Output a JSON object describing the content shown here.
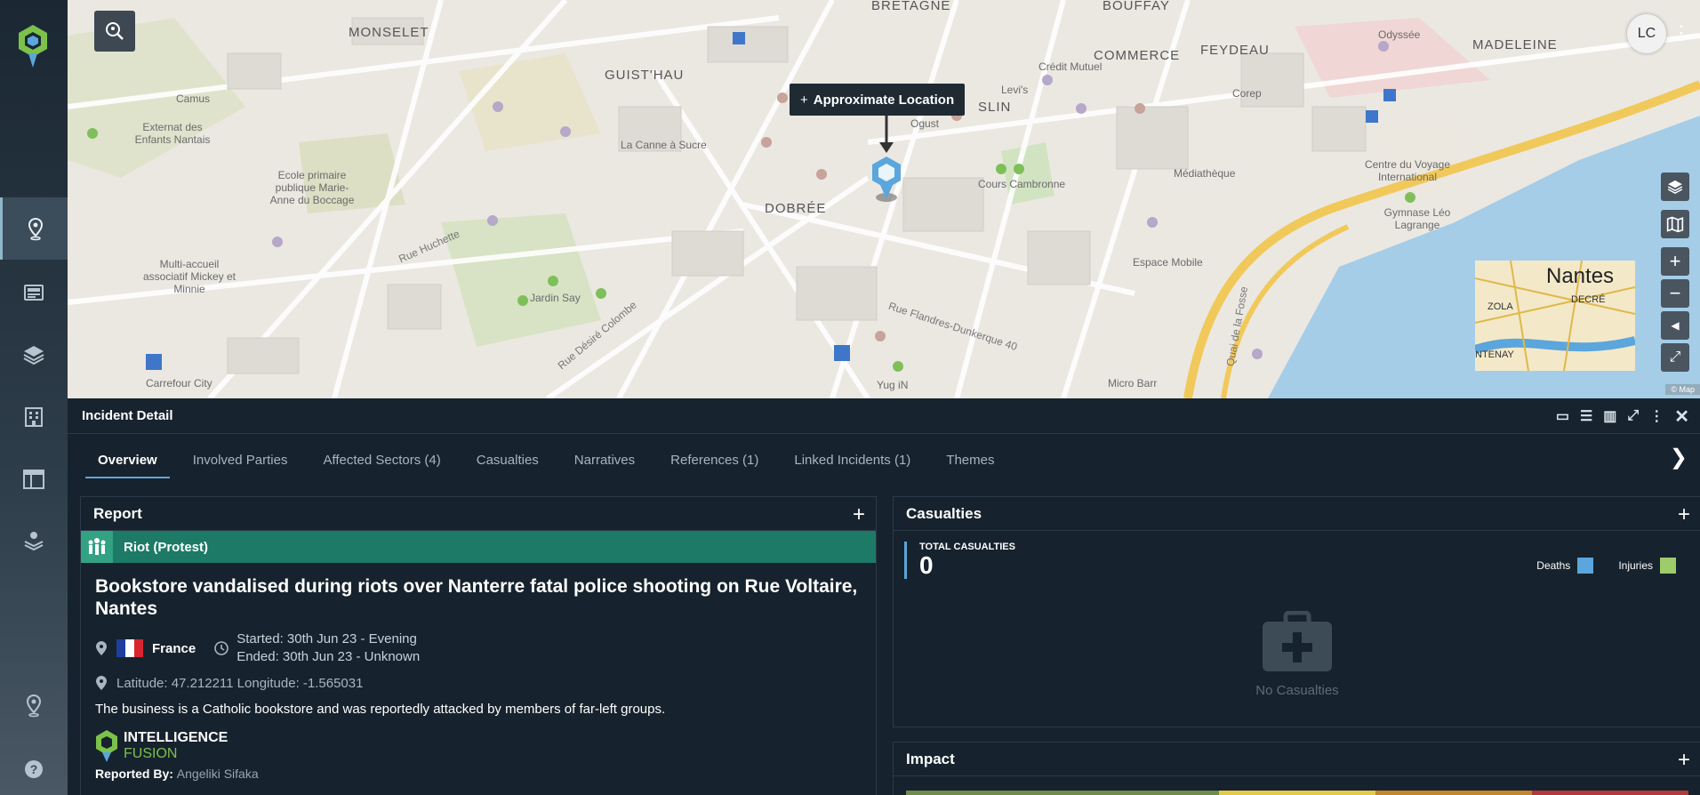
{
  "user": {
    "initials": "LC"
  },
  "map": {
    "tooltip": "Approximate Location",
    "labels": {
      "monselet": "MONSELET",
      "bretagne": "BRETAGNE",
      "bouffay": "BOUFFAY",
      "commerce": "COMMERCE",
      "feydeau": "FEYDEAU",
      "madeleine": "MADELEINE",
      "guisthau": "GUIST'HAU",
      "dobree": "DOBRÉE",
      "graslin": "SLIN",
      "camus": "Camus",
      "externat": "Externat des Enfants Nantais",
      "ecole": "Ecole primaire publique Marie-Anne du Boccage",
      "multiaccueil": "Multi-accueil associatif Mickey et Minnie",
      "carrefour": "Carrefour City",
      "jardin": "Jardin Say",
      "canne": "La Canne à Sucre",
      "ogust": "Ogust",
      "credit": "Crédit Mutuel",
      "levis": "Levi's",
      "corep": "Corep",
      "mediatheque": "Médiathèque",
      "cambronne": "Cours Cambronne",
      "espace": "Espace Mobile",
      "centre": "Centre du Voyage International",
      "gymnase": "Gymnase Léo Lagrange",
      "yug": "Yug iN",
      "microbarr": "Micro Barr",
      "rue_desire": "Rue Désiré Colombe",
      "rue_flandres": "Rue Flandres-Dunkerque 40",
      "rue_huchette": "Rue Huchette",
      "quai": "Quai de la Fosse",
      "odyssee": "Odyssée"
    },
    "minimap": {
      "title": "Nantes",
      "l1": "DECRÉ",
      "l2": "ZOLA",
      "l3": "NTENAY"
    },
    "attribution": "© Map"
  },
  "panel": {
    "title": "Incident Detail",
    "tabs": [
      "Overview",
      "Involved Parties",
      "Affected Sectors (4)",
      "Casualties",
      "Narratives",
      "References (1)",
      "Linked Incidents (1)",
      "Themes"
    ]
  },
  "report": {
    "heading": "Report",
    "type": "Riot (Protest)",
    "title": "Bookstore vandalised during riots over Nanterre fatal police shooting on Rue Voltaire, Nantes",
    "country": "France",
    "started": "Started: 30th Jun 23 - Evening",
    "ended": "Ended: 30th Jun 23 - Unknown",
    "latlon": "Latitude: 47.212211 Longitude: -1.565031",
    "description": "The business is a Catholic bookstore and was reportedly attacked by members of far-left groups.",
    "source_line1": "INTELLIGENCE",
    "source_line2": "FUSION",
    "reported_by_label": "Reported By:",
    "reported_by": "Angeliki Sifaka"
  },
  "casualties": {
    "heading": "Casualties",
    "total_label": "TOTAL CASUALTIES",
    "total": "0",
    "legend": [
      {
        "label": "Deaths",
        "color": "#5ba6dc"
      },
      {
        "label": "Injuries",
        "color": "#9dcc6a"
      }
    ],
    "empty": "No Casualties"
  },
  "impact": {
    "heading": "Impact",
    "colors": [
      "#6f8c4a",
      "#6f8c4a",
      "#e6c84a",
      "#c4862c",
      "#b33a3a"
    ]
  }
}
